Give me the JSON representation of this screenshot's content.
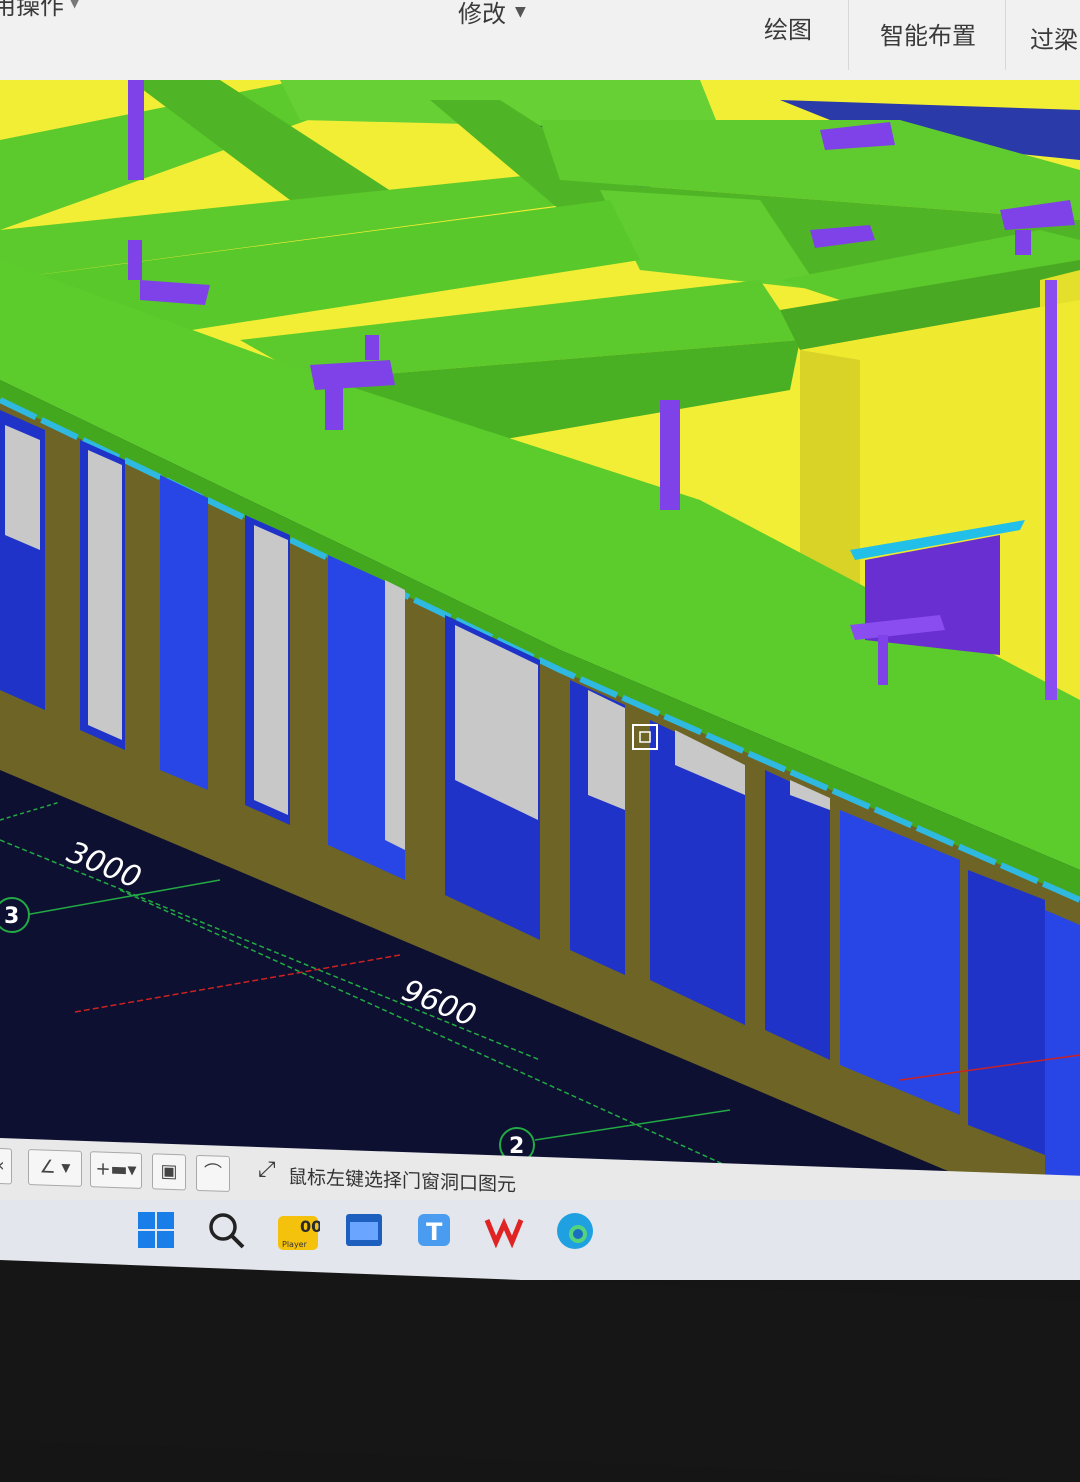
{
  "ribbon": {
    "tabs": [
      "用操作",
      "修改",
      "绘图",
      "智能布置",
      "过梁"
    ]
  },
  "viewport": {
    "dimensions": [
      "3000",
      "9600"
    ],
    "axis_markers": [
      "3",
      "2"
    ],
    "colors": {
      "beam": "#58c82a",
      "slab": "#f2ee35",
      "wall": "#6d6425",
      "opening": "#1f33c8",
      "column": "#7f41e8",
      "background": "#0d1030"
    }
  },
  "statusbar": {
    "message": "鼠标左键选择门窗洞口图元"
  },
  "taskbar": {
    "icons": [
      "windows-start-icon",
      "search-icon",
      "player-app-icon",
      "calendar-app-icon",
      "text-app-icon",
      "wps-icon",
      "edge-icon"
    ],
    "player_label": "Player"
  }
}
